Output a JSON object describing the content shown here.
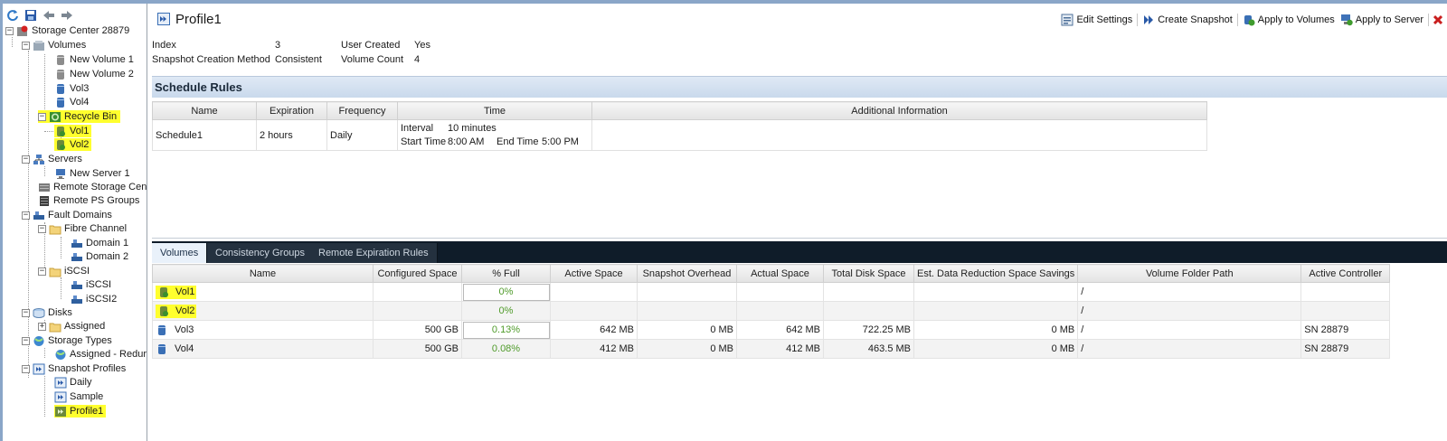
{
  "tree": {
    "root": "Storage Center 28879",
    "volumes": "Volumes",
    "new_volume_1": "New Volume 1",
    "new_volume_2": "New Volume 2",
    "vol3": "Vol3",
    "vol4": "Vol4",
    "recycle_bin": "Recycle Bin",
    "rb_vol1": "Vol1",
    "rb_vol2": "Vol2",
    "servers": "Servers",
    "new_server_1": "New Server 1",
    "remote_storage_center": "Remote Storage Cente",
    "remote_ps_groups": "Remote PS Groups",
    "fault_domains": "Fault Domains",
    "fibre_channel": "Fibre Channel",
    "domain_1": "Domain 1",
    "domain_2": "Domain 2",
    "iscsi": "iSCSI",
    "iscsi_1": "iSCSI",
    "iscsi_2": "iSCSI2",
    "disks": "Disks",
    "assigned": "Assigned",
    "storage_types": "Storage Types",
    "assigned_redundant": "Assigned - Redur",
    "snapshot_profiles": "Snapshot Profiles",
    "daily": "Daily",
    "sample": "Sample",
    "profile1": "Profile1"
  },
  "header": {
    "title": "Profile1",
    "actions": {
      "edit_settings": "Edit Settings",
      "create_snapshot": "Create Snapshot",
      "apply_to_volumes": "Apply to Volumes",
      "apply_to_server": "Apply to Server"
    }
  },
  "properties": {
    "index_label": "Index",
    "index_value": "3",
    "method_label": "Snapshot Creation Method",
    "method_value": "Consistent",
    "user_created_label": "User Created",
    "user_created_value": "Yes",
    "volume_count_label": "Volume Count",
    "volume_count_value": "4"
  },
  "schedule": {
    "heading": "Schedule Rules",
    "columns": [
      "Name",
      "Expiration",
      "Frequency",
      "Time",
      "Additional Information"
    ],
    "row": {
      "name": "Schedule1",
      "expiration": "2 hours",
      "frequency": "Daily",
      "interval_label": "Interval",
      "interval_value": "10 minutes",
      "start_label": "Start Time",
      "start_value": "8:00 AM",
      "end_label": "End Time",
      "end_value": "5:00 PM",
      "additional": ""
    }
  },
  "tabs": [
    "Volumes",
    "Consistency Groups",
    "Remote Expiration Rules"
  ],
  "volumes_table": {
    "columns": [
      "Name",
      "Configured Space",
      "% Full",
      "Active Space",
      "Snapshot Overhead",
      "Actual Space",
      "Total Disk Space",
      "Est. Data Reduction Space Savings",
      "Volume Folder Path",
      "Active Controller"
    ],
    "rows": [
      [
        "Vol1",
        "",
        "0%",
        "",
        "",
        "",
        "",
        "",
        "/",
        ""
      ],
      [
        "Vol2",
        "",
        "0%",
        "",
        "",
        "",
        "",
        "",
        "/",
        ""
      ],
      [
        "Vol3",
        "500 GB",
        "0.13%",
        "642 MB",
        "0 MB",
        "642 MB",
        "722.25 MB",
        "0 MB",
        "/",
        "SN 28879"
      ],
      [
        "Vol4",
        "500 GB",
        "0.08%",
        "412 MB",
        "0 MB",
        "412 MB",
        "463.5 MB",
        "0 MB",
        "/",
        "SN 28879"
      ]
    ]
  },
  "colors": {
    "highlight": "#ffff2e",
    "tab_bar": "#0f1c29",
    "section_header": "#c9d9ec",
    "percent_text": "#4f9b2a"
  }
}
